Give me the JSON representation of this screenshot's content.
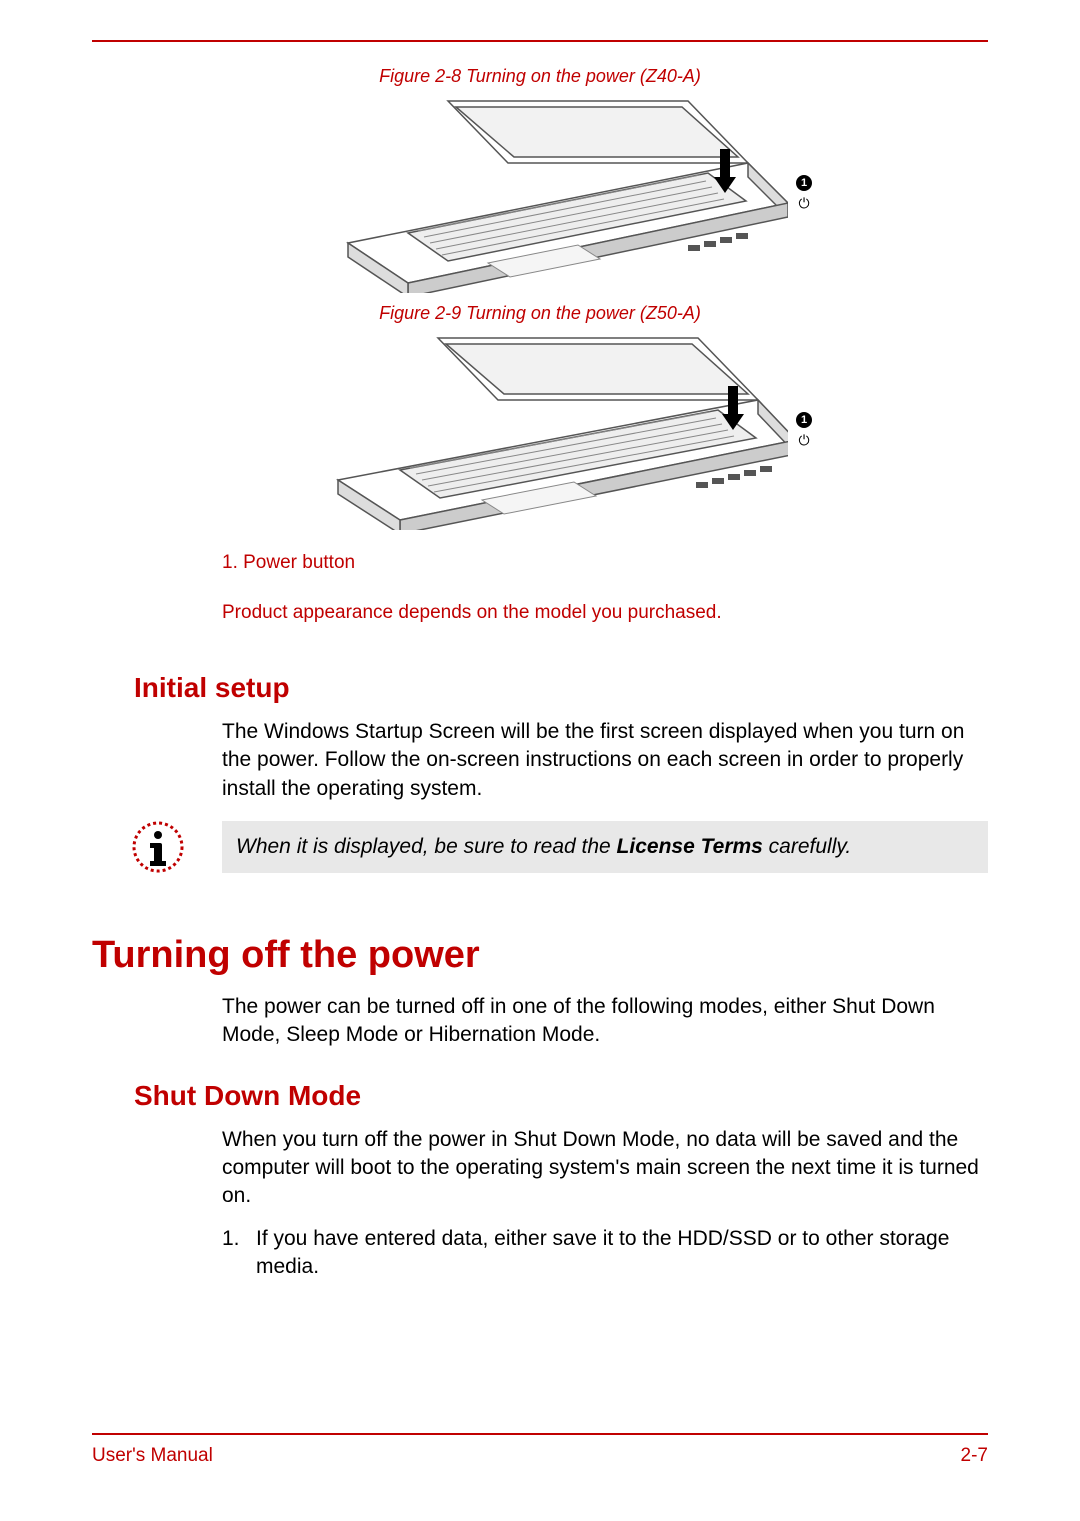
{
  "figures": {
    "f1_caption": "Figure 2-8 Turning on the power (Z40-A)",
    "f2_caption": "Figure 2-9 Turning on the power (Z50-A)",
    "callout_num": "1",
    "callout_sym": "⏻"
  },
  "legend": "1. Power button",
  "appearance_note": "Product appearance depends on the model you purchased.",
  "initial_setup": {
    "heading": "Initial setup",
    "body": "The Windows Startup Screen will be the first screen displayed when you turn on the power. Follow the on-screen instructions on each screen in order to properly install the operating system.",
    "info_pre": "When it is displayed, be sure to read the ",
    "info_bold": "License Terms",
    "info_post": " carefully."
  },
  "turning_off": {
    "heading": "Turning off the power",
    "intro": "The power can be turned off in one of the following modes, either Shut Down Mode, Sleep Mode or Hibernation Mode."
  },
  "shut_down": {
    "heading": "Shut Down Mode",
    "body": "When you turn off the power in Shut Down Mode, no data will be saved and the computer will boot to the operating system's main screen the next time it is turned on.",
    "step1_num": "1.",
    "step1": "If you have entered data, either save it to the HDD/SSD or to other storage media."
  },
  "footer": {
    "left": "User's Manual",
    "right": "2-7"
  }
}
